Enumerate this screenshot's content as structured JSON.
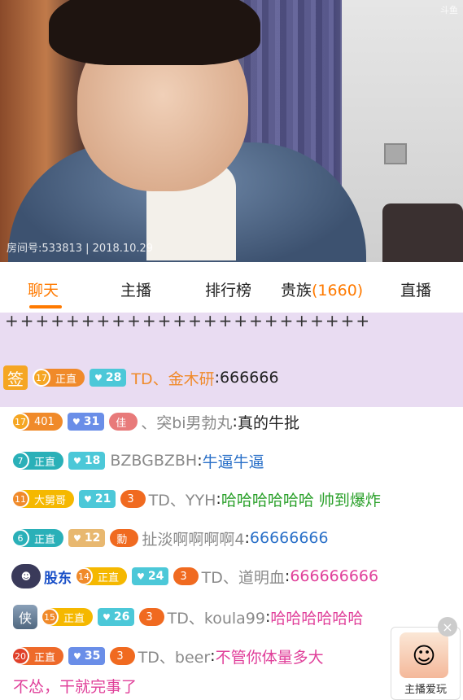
{
  "video": {
    "watermark": "斗鱼",
    "room_info": "房间号:533813 | 2018.10.29"
  },
  "tabs": {
    "items": [
      {
        "label": "聊天",
        "active": true
      },
      {
        "label": "主播"
      },
      {
        "label": "排行榜"
      },
      {
        "label": "贵族",
        "count": "(1660)"
      },
      {
        "label": "直播"
      }
    ]
  },
  "chat": {
    "crosses": "++++++++++++++++++++++++",
    "sign_badge": "签",
    "rows": [
      {
        "level": "17",
        "level_text": "正直",
        "fan": "28",
        "user": "TD、金木研",
        "msg": "666666"
      },
      {
        "level": "17",
        "level_text": "401",
        "fan": "31",
        "vip": "佳",
        "user": "、突bi男勃丸",
        "msg": "真的牛批"
      },
      {
        "level": "7",
        "level_text": "正直",
        "fan": "18",
        "user": "BZBGBZBH",
        "msg": "牛逼牛逼"
      },
      {
        "level": "11",
        "level_text": "大舅哥",
        "fan": "21",
        "vip": "3",
        "user": "TD、YYH",
        "msg": "哈哈哈哈哈哈 帅到爆炸"
      },
      {
        "level": "6",
        "level_text": "正直",
        "fan": "12",
        "vip": "勳",
        "user": "扯淡啊啊啊啊4",
        "msg": "66666666"
      },
      {
        "badge": "股东",
        "level": "14",
        "level_text": "正直",
        "fan": "24",
        "vip": "3",
        "user": "TD、道明血",
        "msg": "666666666"
      },
      {
        "shield": "侠",
        "level": "15",
        "level_text": "正直",
        "fan": "26",
        "vip": "3",
        "user": "TD、koula99",
        "msg": "哈哈哈哈哈哈"
      },
      {
        "level": "20",
        "level_text": "正直",
        "fan": "35",
        "vip": "3",
        "user": "TD、beer",
        "msg": "不管你体量多大"
      }
    ],
    "continuation": "不怂，干就完事了"
  },
  "promo": {
    "label": "主播爱玩",
    "close": "×"
  }
}
